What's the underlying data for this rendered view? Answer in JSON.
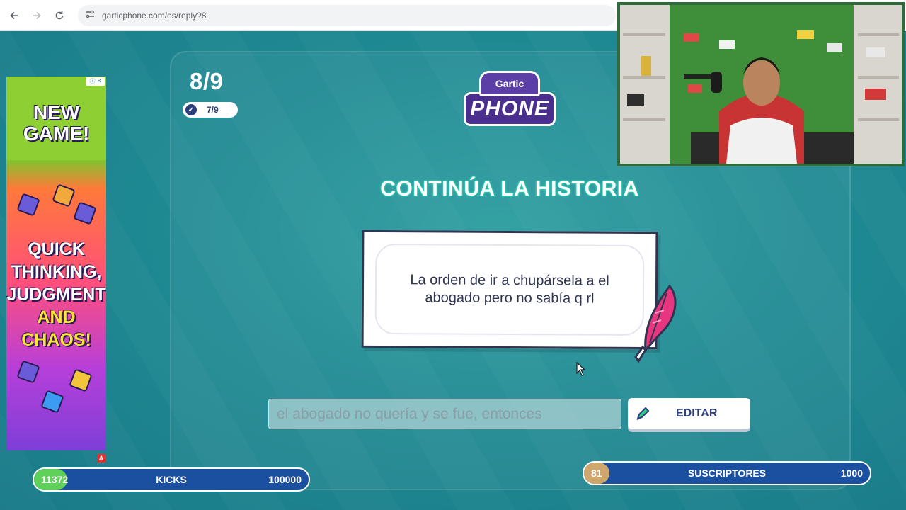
{
  "browser": {
    "url": "garticphone.com/es/reply?8",
    "icons": [
      "back-icon",
      "forward-icon",
      "reload-icon",
      "site-settings-icon"
    ]
  },
  "game": {
    "round": "8/9",
    "done_count": "7/9",
    "logo_top": "Gartic",
    "logo_bottom": "PHONE",
    "heading": "CONTINÚA LA HISTORIA",
    "story_text": "La orden de ir a chupársela a el abogado pero no sabía q rl",
    "answer_value": "el abogado no quería y se fue, entonces",
    "edit_label": "EDITAR"
  },
  "ad": {
    "line1": "NEW",
    "line2": "GAME!",
    "line3": "QUICK",
    "line4": "THINKING,",
    "line5": "JUDGMENT",
    "line6": "AND",
    "line7": "CHAOS!",
    "badge": "A"
  },
  "stream": {
    "kicks": {
      "value": "11372",
      "label": "KICKS",
      "goal": "100000",
      "progress": 0.11372
    },
    "subs": {
      "value": "81",
      "label": "SUSCRIPTORES",
      "goal": "1000",
      "progress": 0.081
    }
  },
  "colors": {
    "background": "#1f8a93",
    "accent_navy": "#2d3e7a",
    "heading_glow": "#28e0b8",
    "kicks_fill": "#5fd15a",
    "subs_fill": "#cfa76c",
    "bar_bg": "#1b4fa0"
  }
}
